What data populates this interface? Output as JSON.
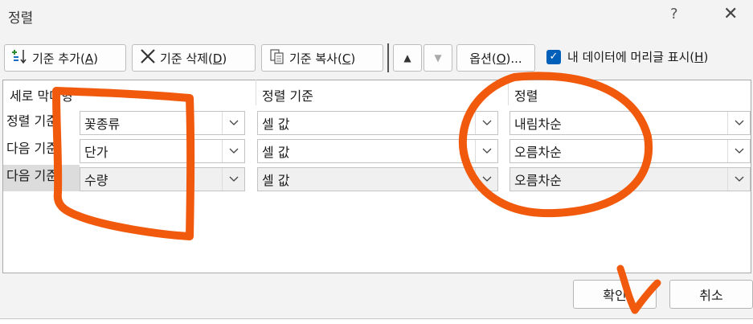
{
  "window": {
    "title": "정렬",
    "help_label": "?",
    "close_label": "✕"
  },
  "toolbar": {
    "add_level": {
      "text": "기준 추가(",
      "key": "A",
      "end": ")"
    },
    "delete_level": {
      "text": "기준 삭제(",
      "key": "D",
      "end": ")"
    },
    "copy_level": {
      "text": "기준 복사(",
      "key": "C",
      "end": ")"
    },
    "options": {
      "text": "옵션(",
      "key": "O",
      "end": ")..."
    },
    "move_up_glyph": "▲",
    "move_down_glyph": "▼",
    "header_checkbox": {
      "text": "내 데이터에 머리글 표시(",
      "key": "H",
      "end": ")",
      "checked": true
    }
  },
  "grid": {
    "headers": {
      "column": "세로 막대형",
      "sort_on": "정렬 기준",
      "order": "정렬"
    },
    "rows": [
      {
        "label": "정렬 기준",
        "column": "꽃종류",
        "sort_on": "셀 값",
        "order": "내림차순"
      },
      {
        "label": "다음 기준",
        "column": "단가",
        "sort_on": "셀 값",
        "order": "오름차순"
      },
      {
        "label": "다음 기준",
        "column": "수량",
        "sort_on": "셀 값",
        "order": "오름차순"
      }
    ]
  },
  "buttons": {
    "ok": "확인",
    "cancel": "취소"
  },
  "colors": {
    "annotation": "#f15a0c",
    "checkbox": "#005fb8"
  },
  "icons": [
    "add-level-icon",
    "delete-x-icon",
    "copy-icon",
    "chevron-down-icon",
    "checkmark-icon"
  ]
}
